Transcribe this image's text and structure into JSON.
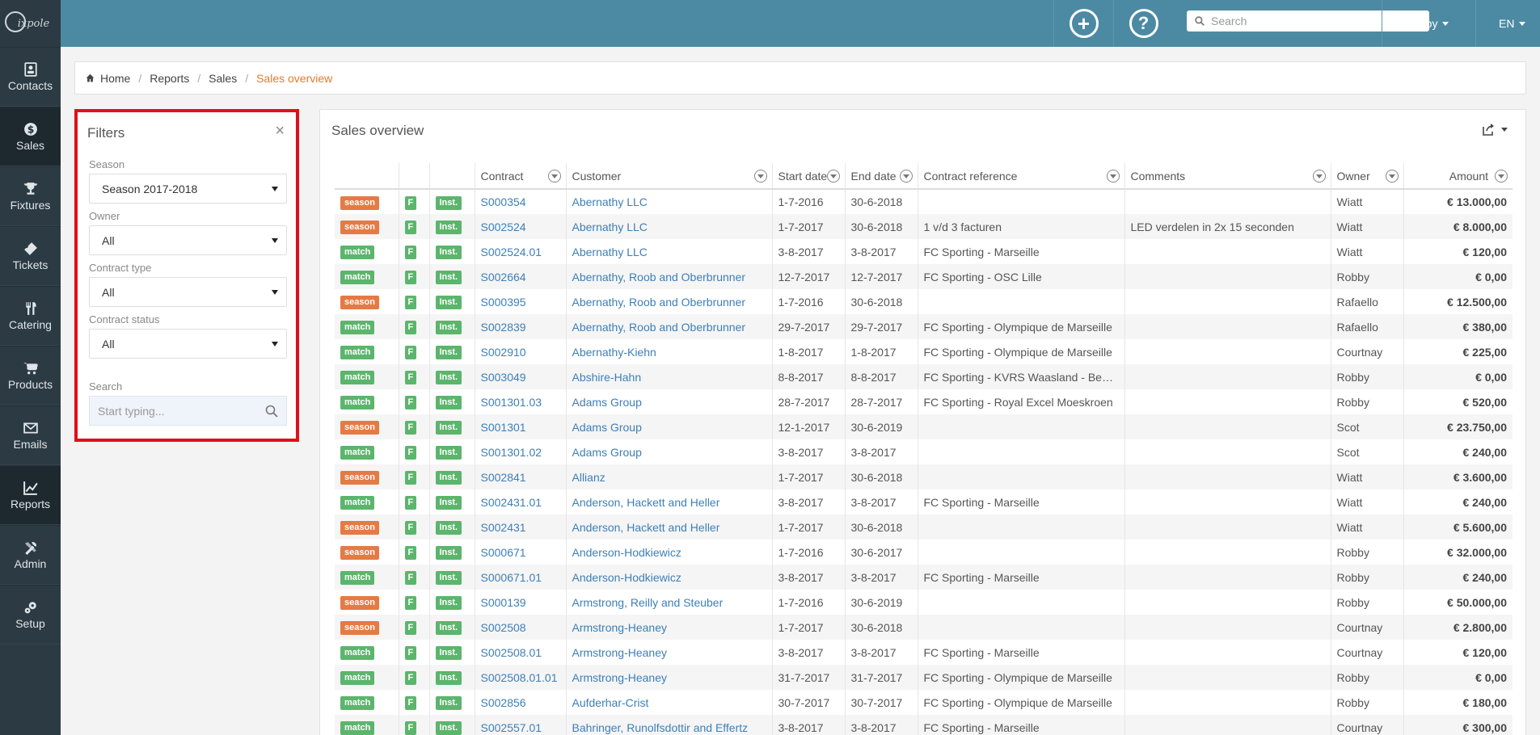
{
  "app": {
    "logo_text": "ixpole"
  },
  "sidebar": {
    "items": [
      {
        "label": "Contacts",
        "icon": "contacts-icon"
      },
      {
        "label": "Sales",
        "icon": "dollar-icon"
      },
      {
        "label": "Fixtures",
        "icon": "trophy-icon"
      },
      {
        "label": "Tickets",
        "icon": "ticket-icon"
      },
      {
        "label": "Catering",
        "icon": "cutlery-icon"
      },
      {
        "label": "Products",
        "icon": "cart-icon"
      },
      {
        "label": "Emails",
        "icon": "envelope-icon"
      },
      {
        "label": "Reports",
        "icon": "chart-icon"
      },
      {
        "label": "Admin",
        "icon": "tools-icon"
      },
      {
        "label": "Setup",
        "icon": "gears-icon"
      }
    ]
  },
  "topbar": {
    "search_placeholder": "Search",
    "user": "Robby",
    "language": "EN",
    "add_symbol": "+",
    "help_symbol": "?"
  },
  "breadcrumb": {
    "home": "Home",
    "reports": "Reports",
    "sales": "Sales",
    "current": "Sales overview"
  },
  "filters": {
    "title": "Filters",
    "close": "×",
    "season_label": "Season",
    "season_value": "Season 2017-2018",
    "owner_label": "Owner",
    "owner_value": "All",
    "type_label": "Contract type",
    "type_value": "All",
    "status_label": "Contract status",
    "status_value": "All",
    "search_label": "Search",
    "search_placeholder": "Start typing..."
  },
  "panel": {
    "title": "Sales overview",
    "columns": [
      "Contract",
      "Customer",
      "Start date",
      "End date",
      "Contract reference",
      "Comments",
      "Owner",
      "Amount"
    ],
    "rows": [
      {
        "type": "season",
        "f": "F",
        "inst": "Inst.",
        "contract": "S000354",
        "customer": "Abernathy LLC",
        "start": "1-7-2016",
        "end": "30-6-2018",
        "ref": "",
        "comments": "",
        "owner": "Wiatt",
        "amount": "€ 13.000,00"
      },
      {
        "type": "season",
        "f": "F",
        "inst": "Inst.",
        "contract": "S002524",
        "customer": "Abernathy LLC",
        "start": "1-7-2017",
        "end": "30-6-2018",
        "ref": "1 v/d 3 facturen",
        "comments": "LED verdelen in 2x 15 seconden",
        "owner": "Wiatt",
        "amount": "€ 8.000,00"
      },
      {
        "type": "match",
        "f": "F",
        "inst": "Inst.",
        "contract": "S002524.01",
        "customer": "Abernathy LLC",
        "start": "3-8-2017",
        "end": "3-8-2017",
        "ref": "FC Sporting - Marseille",
        "comments": "",
        "owner": "Wiatt",
        "amount": "€ 120,00"
      },
      {
        "type": "match",
        "f": "F",
        "inst": "Inst.",
        "contract": "S002664",
        "customer": "Abernathy, Roob and Oberbrunner",
        "start": "12-7-2017",
        "end": "12-7-2017",
        "ref": "FC Sporting - OSC Lille",
        "comments": "",
        "owner": "Robby",
        "amount": "€ 0,00"
      },
      {
        "type": "season",
        "f": "F",
        "inst": "Inst.",
        "contract": "S000395",
        "customer": "Abernathy, Roob and Oberbrunner",
        "start": "1-7-2016",
        "end": "30-6-2018",
        "ref": "",
        "comments": "",
        "owner": "Rafaello",
        "amount": "€ 12.500,00"
      },
      {
        "type": "match",
        "f": "F",
        "inst": "Inst.",
        "contract": "S002839",
        "customer": "Abernathy, Roob and Oberbrunner",
        "start": "29-7-2017",
        "end": "29-7-2017",
        "ref": "FC Sporting - Olympique de Marseille",
        "comments": "",
        "owner": "Rafaello",
        "amount": "€ 380,00"
      },
      {
        "type": "match",
        "f": "F",
        "inst": "Inst.",
        "contract": "S002910",
        "customer": "Abernathy-Kiehn",
        "start": "1-8-2017",
        "end": "1-8-2017",
        "ref": "FC Sporting - Olympique de Marseille",
        "comments": "",
        "owner": "Courtnay",
        "amount": "€ 225,00"
      },
      {
        "type": "match",
        "f": "F",
        "inst": "Inst.",
        "contract": "S003049",
        "customer": "Abshire-Hahn",
        "start": "8-8-2017",
        "end": "8-8-2017",
        "ref": "FC Sporting - KVRS Waasland - Bever…",
        "comments": "",
        "owner": "Robby",
        "amount": "€ 0,00"
      },
      {
        "type": "match",
        "f": "F",
        "inst": "Inst.",
        "contract": "S001301.03",
        "customer": "Adams Group",
        "start": "28-7-2017",
        "end": "28-7-2017",
        "ref": "FC Sporting - Royal Excel Moeskroen",
        "comments": "",
        "owner": "Robby",
        "amount": "€ 520,00"
      },
      {
        "type": "season",
        "f": "F",
        "inst": "Inst.",
        "contract": "S001301",
        "customer": "Adams Group",
        "start": "12-1-2017",
        "end": "30-6-2019",
        "ref": "",
        "comments": "",
        "owner": "Scot",
        "amount": "€ 23.750,00"
      },
      {
        "type": "match",
        "f": "F",
        "inst": "Inst.",
        "contract": "S001301.02",
        "customer": "Adams Group",
        "start": "3-8-2017",
        "end": "3-8-2017",
        "ref": "",
        "comments": "",
        "owner": "Scot",
        "amount": "€ 240,00"
      },
      {
        "type": "season",
        "f": "F",
        "inst": "Inst.",
        "contract": "S002841",
        "customer": "Allianz",
        "start": "1-7-2017",
        "end": "30-6-2018",
        "ref": "",
        "comments": "",
        "owner": "Wiatt",
        "amount": "€ 3.600,00"
      },
      {
        "type": "match",
        "f": "F",
        "inst": "Inst.",
        "contract": "S002431.01",
        "customer": "Anderson, Hackett and Heller",
        "start": "3-8-2017",
        "end": "3-8-2017",
        "ref": "FC Sporting - Marseille",
        "comments": "",
        "owner": "Wiatt",
        "amount": "€ 240,00"
      },
      {
        "type": "season",
        "f": "F",
        "inst": "Inst.",
        "contract": "S002431",
        "customer": "Anderson, Hackett and Heller",
        "start": "1-7-2017",
        "end": "30-6-2018",
        "ref": "",
        "comments": "",
        "owner": "Wiatt",
        "amount": "€ 5.600,00"
      },
      {
        "type": "season",
        "f": "F",
        "inst": "Inst.",
        "contract": "S000671",
        "customer": "Anderson-Hodkiewicz",
        "start": "1-7-2016",
        "end": "30-6-2017",
        "ref": "",
        "comments": "",
        "owner": "Robby",
        "amount": "€ 32.000,00"
      },
      {
        "type": "match",
        "f": "F",
        "inst": "Inst.",
        "contract": "S000671.01",
        "customer": "Anderson-Hodkiewicz",
        "start": "3-8-2017",
        "end": "3-8-2017",
        "ref": "FC Sporting - Marseille",
        "comments": "",
        "owner": "Robby",
        "amount": "€ 240,00"
      },
      {
        "type": "season",
        "f": "F",
        "inst": "Inst.",
        "contract": "S000139",
        "customer": "Armstrong, Reilly and Steuber",
        "start": "1-7-2016",
        "end": "30-6-2019",
        "ref": "",
        "comments": "",
        "owner": "Robby",
        "amount": "€ 50.000,00"
      },
      {
        "type": "season",
        "f": "F",
        "inst": "Inst.",
        "contract": "S002508",
        "customer": "Armstrong-Heaney",
        "start": "1-7-2017",
        "end": "30-6-2018",
        "ref": "",
        "comments": "",
        "owner": "Courtnay",
        "amount": "€ 2.800,00"
      },
      {
        "type": "match",
        "f": "F",
        "inst": "Inst.",
        "contract": "S002508.01",
        "customer": "Armstrong-Heaney",
        "start": "3-8-2017",
        "end": "3-8-2017",
        "ref": "FC Sporting - Marseille",
        "comments": "",
        "owner": "Courtnay",
        "amount": "€ 120,00"
      },
      {
        "type": "match",
        "f": "F",
        "inst": "Inst.",
        "contract": "S002508.01.01",
        "customer": "Armstrong-Heaney",
        "start": "31-7-2017",
        "end": "31-7-2017",
        "ref": "FC Sporting - Olympique de Marseille",
        "comments": "",
        "owner": "Robby",
        "amount": "€ 0,00"
      },
      {
        "type": "match",
        "f": "F",
        "inst": "Inst.",
        "contract": "S002856",
        "customer": "Aufderhar-Crist",
        "start": "30-7-2017",
        "end": "30-7-2017",
        "ref": "FC Sporting - Olympique de Marseille",
        "comments": "",
        "owner": "Robby",
        "amount": "€ 180,00"
      },
      {
        "type": "match",
        "f": "F",
        "inst": "Inst.",
        "contract": "S002557.01",
        "customer": "Bahringer, Runolfsdottir and Effertz",
        "start": "3-8-2017",
        "end": "3-8-2017",
        "ref": "FC Sporting - Marseille",
        "comments": "",
        "owner": "Courtnay",
        "amount": "€ 300,00"
      }
    ]
  },
  "colors": {
    "topbar": "#4c8aa3",
    "sidebar": "#2c3a43",
    "season_badge": "#e57a44",
    "match_badge": "#5cb56c",
    "link": "#3d7fb8",
    "breadcrumb_current": "#e37a2e",
    "filter_highlight": "#e0101a"
  }
}
